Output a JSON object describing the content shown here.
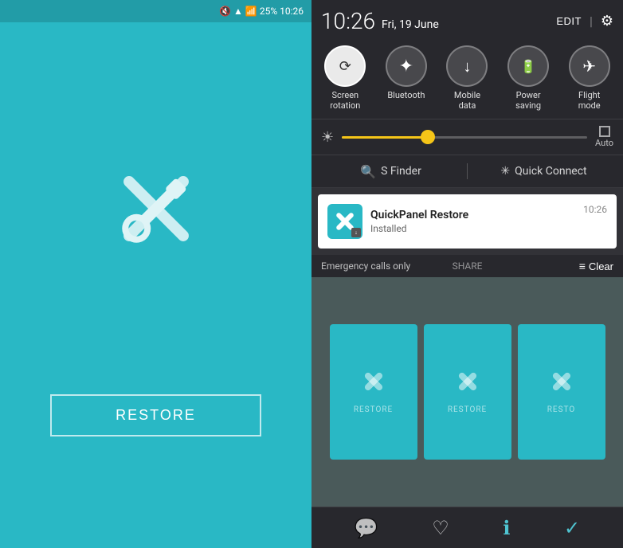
{
  "left": {
    "status_bar": {
      "time": "10:26",
      "battery": "25%"
    },
    "restore_button": "RESTORE"
  },
  "right": {
    "header": {
      "time": "10:26",
      "date": "Fri, 19 June",
      "edit_label": "EDIT",
      "settings_icon": "⚙"
    },
    "toggles": [
      {
        "label": "Screen\nrotation",
        "icon": "⟳",
        "active": true
      },
      {
        "label": "Bluetooth",
        "icon": "✦",
        "active": false
      },
      {
        "label": "Mobile\ndata",
        "icon": "↓",
        "active": false
      },
      {
        "label": "Power\nsaving",
        "icon": "⚡",
        "active": false
      },
      {
        "label": "Flight\nmode",
        "icon": "✈",
        "active": false
      }
    ],
    "brightness": {
      "auto_label": "Auto"
    },
    "search": {
      "s_finder": "S Finder",
      "quick_connect": "Quick Connect"
    },
    "notification": {
      "app_name": "QuickPanel Restore",
      "status": "Installed",
      "time": "10:26"
    },
    "emergency_bar": {
      "text": "Emergency calls only",
      "share": "SHARE",
      "clear": "Clear"
    },
    "bottom_dock": {
      "icons": [
        "💬",
        "♡",
        "ℹ",
        "✓"
      ]
    }
  }
}
